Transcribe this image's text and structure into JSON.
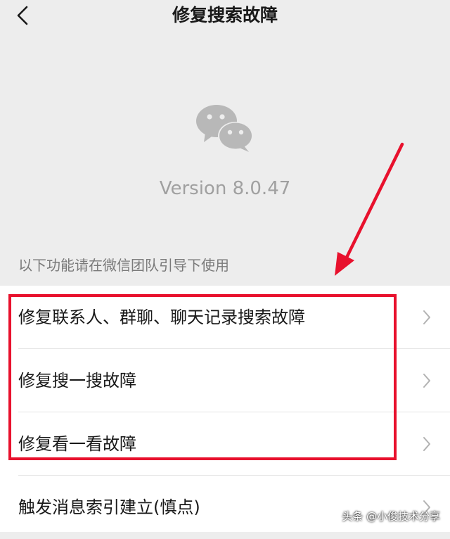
{
  "header": {
    "title": "修复搜索故障",
    "back_icon": "chevron-left-icon"
  },
  "about": {
    "logo_icon": "wechat-logo-icon",
    "version": "Version 8.0.47"
  },
  "section": {
    "hint": "以下功能请在微信团队引导下使用"
  },
  "items": [
    {
      "label": "修复联系人、群聊、聊天记录搜索故障"
    },
    {
      "label": "修复搜一搜故障"
    },
    {
      "label": "修复看一看故障"
    },
    {
      "label": "触发消息索引建立(慎点)"
    }
  ],
  "annotation": {
    "color": "#e8112d"
  },
  "watermark": {
    "text": "头条 @小俊技术分享"
  }
}
